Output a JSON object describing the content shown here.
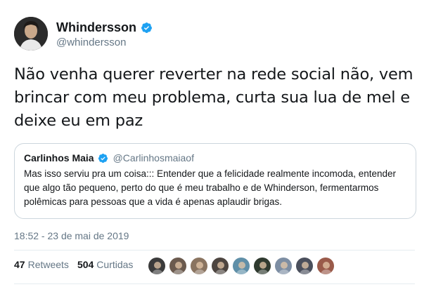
{
  "author": {
    "display_name": "Whindersson",
    "handle": "@whindersson",
    "verified": true
  },
  "tweet": {
    "text": "Não venha querer reverter na rede social não, vem brincar com meu problema, curta sua lua de mel e deixe eu em paz"
  },
  "quoted_tweet": {
    "display_name": "Carlinhos Maia",
    "handle": "@Carlinhosmaiaof",
    "verified": true,
    "text": "Mas isso serviu pra um coisa::: Entender que a felicidade realmente incomoda, entender que algo tão pequeno, perto do que é meu trabalho e de Whinderson, fermentarmos polêmicas para pessoas que a vida é apenas aplaudir brigas."
  },
  "timestamp": "18:52 - 23 de mai de 2019",
  "stats": {
    "retweets_count": "47",
    "retweets_label": "Retweets",
    "likes_count": "504",
    "likes_label": "Curtidas"
  },
  "likers": [
    {
      "name": "liker-1",
      "color": "#3b3b3b"
    },
    {
      "name": "liker-2",
      "color": "#6b5a4e"
    },
    {
      "name": "liker-3",
      "color": "#8a7460"
    },
    {
      "name": "liker-4",
      "color": "#4d4540"
    },
    {
      "name": "liker-5",
      "color": "#5f8fa8"
    },
    {
      "name": "liker-6",
      "color": "#2f3a2f"
    },
    {
      "name": "liker-7",
      "color": "#7d8ea3"
    },
    {
      "name": "liker-8",
      "color": "#4a4f5c"
    },
    {
      "name": "liker-9",
      "color": "#9a5a4a"
    }
  ],
  "colors": {
    "verified_blue": "#1da1f2",
    "secondary_text": "#657786",
    "border": "#ccd6dd"
  }
}
